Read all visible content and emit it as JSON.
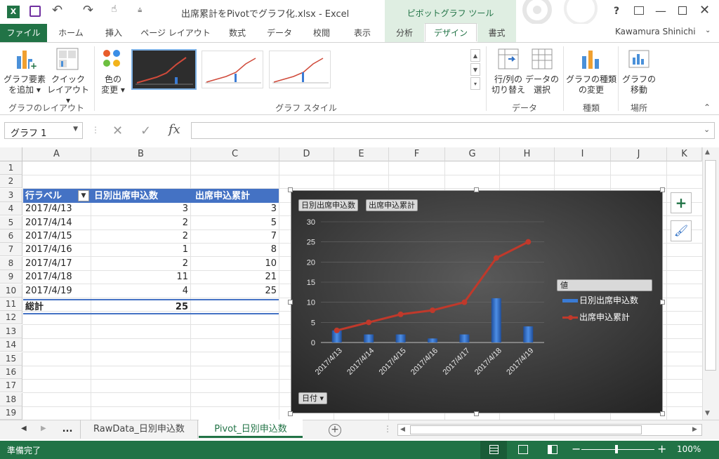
{
  "window": {
    "title": "出席累計をPivotでグラフ化.xlsx - Excel",
    "contextual_tools": "ピボットグラフ ツール",
    "help": "?",
    "user": "Kawamura Shinichi"
  },
  "tabs": [
    "ファイル",
    "ホーム",
    "挿入",
    "ページ レイアウト",
    "数式",
    "データ",
    "校閲",
    "表示",
    "分析",
    "デザイン",
    "書式"
  ],
  "ribbon": {
    "add_element": [
      "グラフ要素",
      "を追加 ▾"
    ],
    "quick_layout": [
      "クイック",
      "レイアウト ▾"
    ],
    "colors": [
      "色の",
      "変更 ▾"
    ],
    "group_layout": "グラフのレイアウト",
    "group_styles": "グラフ スタイル",
    "switch_rowcol": [
      "行/列の",
      "切り替え"
    ],
    "select_data": [
      "データの",
      "選択"
    ],
    "group_data": "データ",
    "change_type": [
      "グラフの種類",
      "の変更"
    ],
    "group_type": "種類",
    "move_chart": [
      "グラフの",
      "移動"
    ],
    "group_location": "場所"
  },
  "formula_bar": {
    "name_box": "グラフ 1",
    "fx": "fx"
  },
  "columns": [
    "A",
    "B",
    "C",
    "D",
    "E",
    "F",
    "G",
    "H",
    "I",
    "J",
    "K"
  ],
  "rows": [
    "1",
    "2",
    "3",
    "4",
    "5",
    "6",
    "7",
    "8",
    "9",
    "10",
    "11",
    "12",
    "13",
    "14",
    "15",
    "16",
    "17",
    "18",
    "19"
  ],
  "pivot": {
    "headers": [
      "行ラベル",
      "日別出席申込数",
      "出席申込累計"
    ],
    "rows": [
      [
        "2017/4/13",
        "3",
        "3"
      ],
      [
        "2017/4/14",
        "2",
        "5"
      ],
      [
        "2017/4/15",
        "2",
        "7"
      ],
      [
        "2017/4/16",
        "1",
        "8"
      ],
      [
        "2017/4/17",
        "2",
        "10"
      ],
      [
        "2017/4/18",
        "11",
        "21"
      ],
      [
        "2017/4/19",
        "4",
        "25"
      ]
    ],
    "total": [
      "総計",
      "25"
    ]
  },
  "chart_buttons": {
    "field1": "日別出席申込数",
    "field2": "出席申込累計",
    "axis_field": "日付 ▾",
    "legend_title": "値"
  },
  "chart_data": {
    "type": "bar",
    "categories": [
      "2017/4/13",
      "2017/4/14",
      "2017/4/15",
      "2017/4/16",
      "2017/4/17",
      "2017/4/18",
      "2017/4/19"
    ],
    "series": [
      {
        "name": "日別出席申込数",
        "type": "bar",
        "values": [
          3,
          2,
          2,
          1,
          2,
          11,
          4
        ],
        "color": "#2e6fc4"
      },
      {
        "name": "出席申込累計",
        "type": "line",
        "values": [
          3,
          5,
          7,
          8,
          10,
          21,
          25
        ],
        "color": "#c0392b"
      }
    ],
    "ylim": [
      0,
      30
    ],
    "yticks": [
      "0",
      "5",
      "10",
      "15",
      "20",
      "25",
      "30"
    ],
    "grid": true,
    "legend": "right"
  },
  "sheets": [
    "...",
    "RawData_日別申込数",
    "Pivot_日別申込数"
  ],
  "status": {
    "ready": "準備完了",
    "zoom": "100%"
  }
}
